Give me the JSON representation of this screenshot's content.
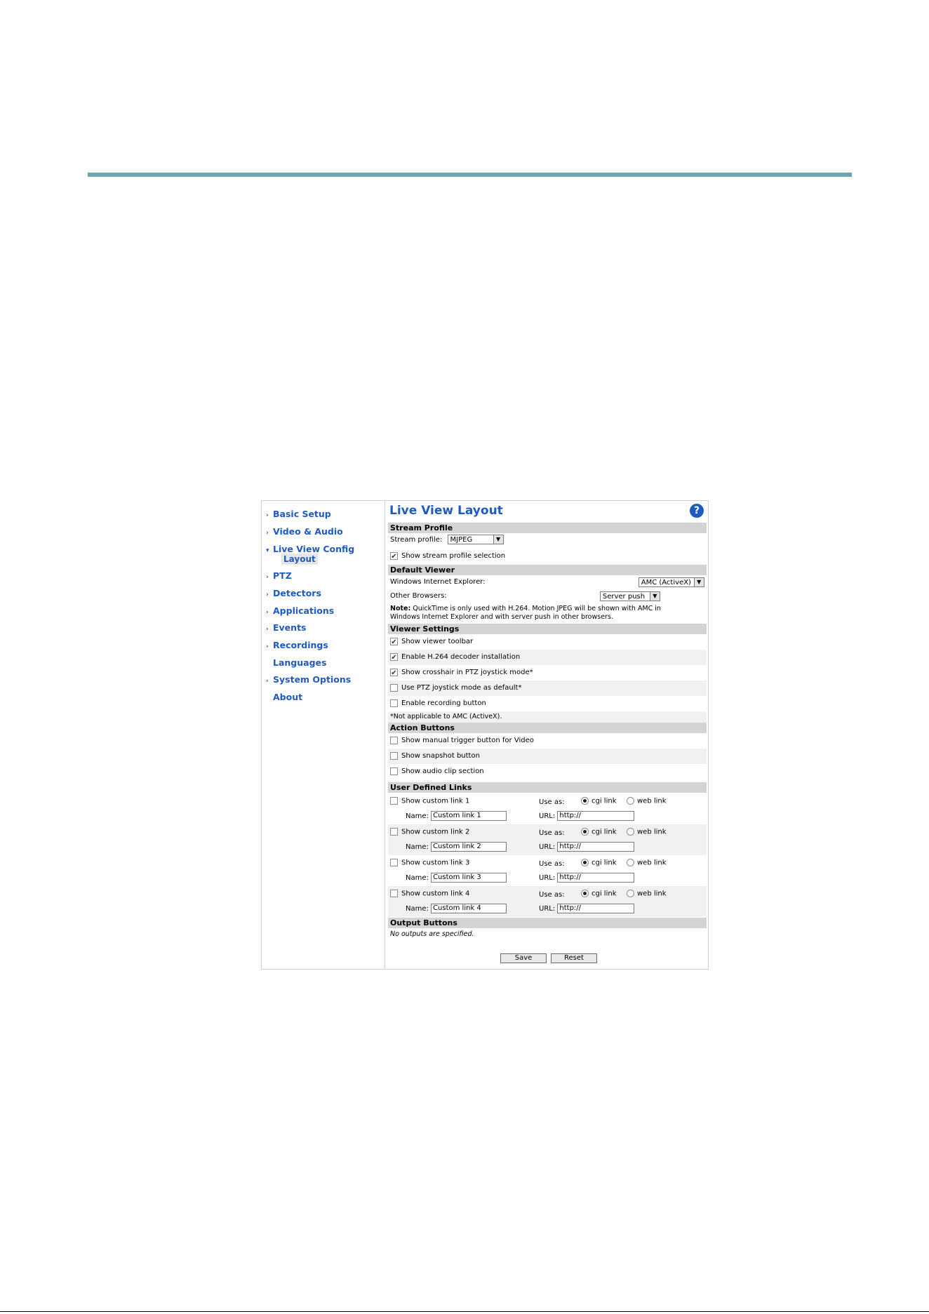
{
  "sidebar": {
    "items": [
      {
        "label": "Basic Setup",
        "arrow": "›"
      },
      {
        "label": "Video & Audio",
        "arrow": "›"
      },
      {
        "label": "Live View Config",
        "arrow": "▾"
      },
      {
        "label": "PTZ",
        "arrow": "›"
      },
      {
        "label": "Detectors",
        "arrow": "›"
      },
      {
        "label": "Applications",
        "arrow": "›"
      },
      {
        "label": "Events",
        "arrow": "›"
      },
      {
        "label": "Recordings",
        "arrow": "›"
      },
      {
        "label": "Languages",
        "arrow": ""
      },
      {
        "label": "System Options",
        "arrow": "›"
      },
      {
        "label": "About",
        "arrow": ""
      }
    ],
    "sub_item": "Layout"
  },
  "main": {
    "title": "Live View Layout",
    "help_icon": "?",
    "stream_profile": {
      "header": "Stream Profile",
      "label": "Stream profile:",
      "value": "MJPEG",
      "show_selection": "Show stream profile selection"
    },
    "default_viewer": {
      "header": "Default Viewer",
      "ie_label": "Windows Internet Explorer:",
      "ie_value": "AMC (ActiveX)",
      "other_label": "Other Browsers:",
      "other_value": "Server push",
      "note_bold": "Note:",
      "note_line1": "QuickTime is only used with H.264. Motion JPEG will be shown with AMC in",
      "note_line2": "Windows Internet Explorer and with server push in other browsers."
    },
    "viewer_settings": {
      "header": "Viewer Settings",
      "items": [
        {
          "label": "Show viewer toolbar",
          "checked": "✔"
        },
        {
          "label": "Enable H.264 decoder installation",
          "checked": "✔"
        },
        {
          "label": "Show crosshair in PTZ joystick mode*",
          "checked": "✔"
        },
        {
          "label": "Use PTZ joystick mode as default*",
          "checked": ""
        },
        {
          "label": "Enable recording button",
          "checked": ""
        }
      ],
      "footnote": "*Not applicable to AMC (ActiveX)."
    },
    "action_buttons": {
      "header": "Action Buttons",
      "items": [
        {
          "label": "Show manual trigger button for Video"
        },
        {
          "label": "Show snapshot button"
        },
        {
          "label": "Show audio clip section"
        }
      ]
    },
    "user_links": {
      "header": "User Defined Links",
      "use_as_label": "Use as:",
      "cgi_label": "cgi link",
      "web_label": "web link",
      "name_label": "Name:",
      "url_label": "URL:",
      "links": [
        {
          "show": "Show custom link 1",
          "name": "Custom link 1",
          "url": "http://"
        },
        {
          "show": "Show custom link 2",
          "name": "Custom link 2",
          "url": "http://"
        },
        {
          "show": "Show custom link 3",
          "name": "Custom link 3",
          "url": "http://"
        },
        {
          "show": "Show custom link 4",
          "name": "Custom link 4",
          "url": "http://"
        }
      ]
    },
    "output_buttons": {
      "header": "Output Buttons",
      "none_text": "No outputs are specified."
    },
    "save_label": "Save",
    "reset_label": "Reset"
  }
}
